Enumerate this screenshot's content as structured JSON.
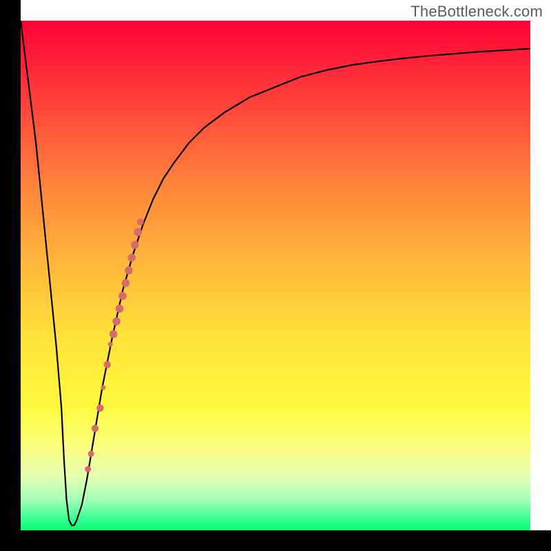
{
  "watermark": "TheBottleneck.com",
  "colors": {
    "background_gradient_top": "#ff0033",
    "background_gradient_bottom": "#0dff6d",
    "curve_stroke": "#000000",
    "marker_fill": "#d76a6a",
    "axis_color": "#000000"
  },
  "chart_data": {
    "type": "line",
    "title": "",
    "xlabel": "",
    "ylabel": "",
    "xlim": [
      0,
      100
    ],
    "ylim": [
      0,
      100
    ],
    "series": [
      {
        "name": "bottleneck-curve",
        "x": [
          0,
          1,
          3,
          5,
          6,
          7,
          8,
          8.5,
          9,
          9.5,
          10,
          10.5,
          11,
          12,
          13,
          14,
          15,
          16,
          18,
          20,
          22,
          24,
          26,
          28,
          30,
          33,
          36,
          40,
          45,
          50,
          55,
          60,
          65,
          70,
          75,
          80,
          85,
          90,
          95,
          100
        ],
        "y": [
          100,
          92,
          76,
          56,
          46,
          36,
          24,
          14,
          6,
          2,
          1,
          1,
          2,
          5,
          10,
          16,
          22,
          28,
          38,
          47,
          54,
          60,
          65,
          69,
          72,
          76,
          79,
          82,
          85,
          87,
          89,
          90.3,
          91.3,
          92,
          92.6,
          93.1,
          93.5,
          93.9,
          94.2,
          94.5
        ]
      }
    ],
    "markers": [
      {
        "x": 14.6,
        "y": 20,
        "r": 5.2
      },
      {
        "x": 15.6,
        "y": 24,
        "r": 5.2
      },
      {
        "x": 16.2,
        "y": 28,
        "r": 3.5
      },
      {
        "x": 17.0,
        "y": 32.5,
        "r": 5.2
      },
      {
        "x": 17.6,
        "y": 36.5,
        "r": 3.5
      },
      {
        "x": 18.2,
        "y": 38.5,
        "r": 5.8
      },
      {
        "x": 18.8,
        "y": 41,
        "r": 5.8
      },
      {
        "x": 19.4,
        "y": 43.5,
        "r": 5.8
      },
      {
        "x": 20.0,
        "y": 46,
        "r": 5.8
      },
      {
        "x": 20.6,
        "y": 48.5,
        "r": 5.8
      },
      {
        "x": 21.2,
        "y": 51,
        "r": 5.8
      },
      {
        "x": 21.8,
        "y": 53.5,
        "r": 5.8
      },
      {
        "x": 22.4,
        "y": 56,
        "r": 5.8
      },
      {
        "x": 23.0,
        "y": 58.5,
        "r": 5.8
      },
      {
        "x": 23.5,
        "y": 60.5,
        "r": 5.0
      },
      {
        "x": 13.2,
        "y": 12,
        "r": 4.5
      },
      {
        "x": 13.8,
        "y": 15,
        "r": 4.5
      }
    ]
  }
}
